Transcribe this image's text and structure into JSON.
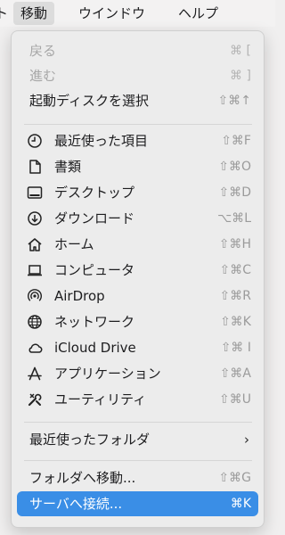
{
  "menubar": {
    "partial_left": "ト",
    "go": "移動",
    "window": "ウインドウ",
    "help": "ヘルプ"
  },
  "menu": {
    "items": [
      {
        "label": "戻る",
        "shortcut": "⌘ [",
        "disabled": true
      },
      {
        "label": "進む",
        "shortcut": "⌘ ]",
        "disabled": true
      },
      {
        "label": "起動ディスクを選択",
        "shortcut": "⇧⌘↑"
      },
      {
        "label": "最近使った項目",
        "shortcut": "⇧⌘F",
        "icon": "clock-icon"
      },
      {
        "label": "書類",
        "shortcut": "⇧⌘O",
        "icon": "document-icon"
      },
      {
        "label": "デスクトップ",
        "shortcut": "⇧⌘D",
        "icon": "desktop-icon"
      },
      {
        "label": "ダウンロード",
        "shortcut": "⌥⌘L",
        "icon": "download-icon"
      },
      {
        "label": "ホーム",
        "shortcut": "⇧⌘H",
        "icon": "home-icon"
      },
      {
        "label": "コンピュータ",
        "shortcut": "⇧⌘C",
        "icon": "laptop-icon"
      },
      {
        "label": "AirDrop",
        "shortcut": "⇧⌘R",
        "icon": "airdrop-icon"
      },
      {
        "label": "ネットワーク",
        "shortcut": "⇧⌘K",
        "icon": "network-icon"
      },
      {
        "label": "iCloud Drive",
        "shortcut": "⇧⌘ I",
        "icon": "cloud-icon"
      },
      {
        "label": "アプリケーション",
        "shortcut": "⇧⌘A",
        "icon": "applications-icon"
      },
      {
        "label": "ユーティリティ",
        "shortcut": "⇧⌘U",
        "icon": "utilities-icon"
      },
      {
        "label": "最近使ったフォルダ",
        "submenu": true
      },
      {
        "label": "フォルダへ移動...",
        "shortcut": "⇧⌘G"
      },
      {
        "label": "サーバへ接続...",
        "shortcut": "⌘K",
        "highlighted": true
      }
    ]
  },
  "colors": {
    "highlight": "#3a8ee6",
    "menu_bg": "#ececec",
    "disabled_text": "#a7a7a7",
    "shortcut_text": "#9b9b9b"
  }
}
